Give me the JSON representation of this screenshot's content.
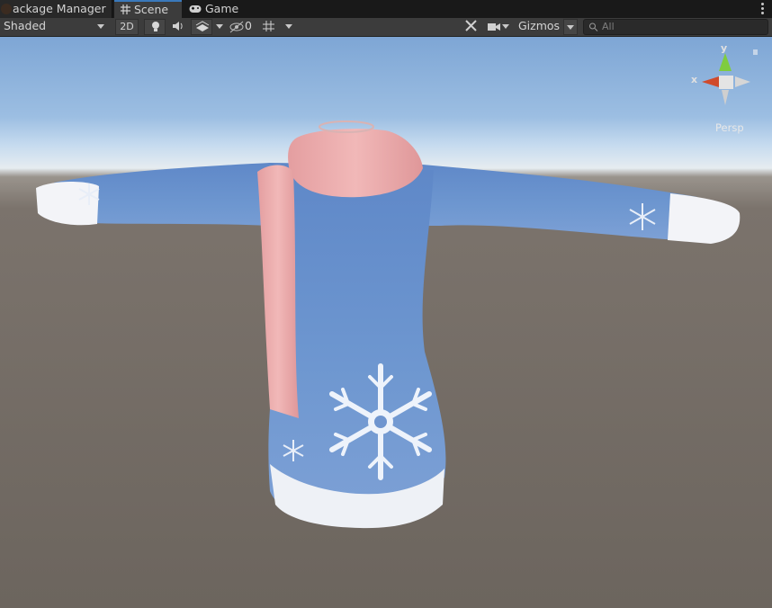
{
  "tabs": [
    {
      "label": "ackage Manager",
      "icon": "package-icon"
    },
    {
      "label": "Scene",
      "icon": "grid-hash-icon",
      "active": true
    },
    {
      "label": "Game",
      "icon": "gamepad-icon"
    }
  ],
  "toolbar": {
    "draw_mode": "Shaded",
    "toggle_2d": "2D",
    "hidden_count": "0",
    "gizmos": "Gizmos",
    "search_placeholder": "All"
  },
  "gizmo": {
    "y_label": "y",
    "x_label": "x",
    "projection": "Persp"
  },
  "scene_object": "winter sweater mesh with pink knit scarf and snowflake pattern",
  "colors": {
    "accent_tab": "#3a79bb",
    "sweater_blue": "#6f95cf",
    "scarf_pink": "#e7a6a7",
    "ground": "#6c655e"
  }
}
